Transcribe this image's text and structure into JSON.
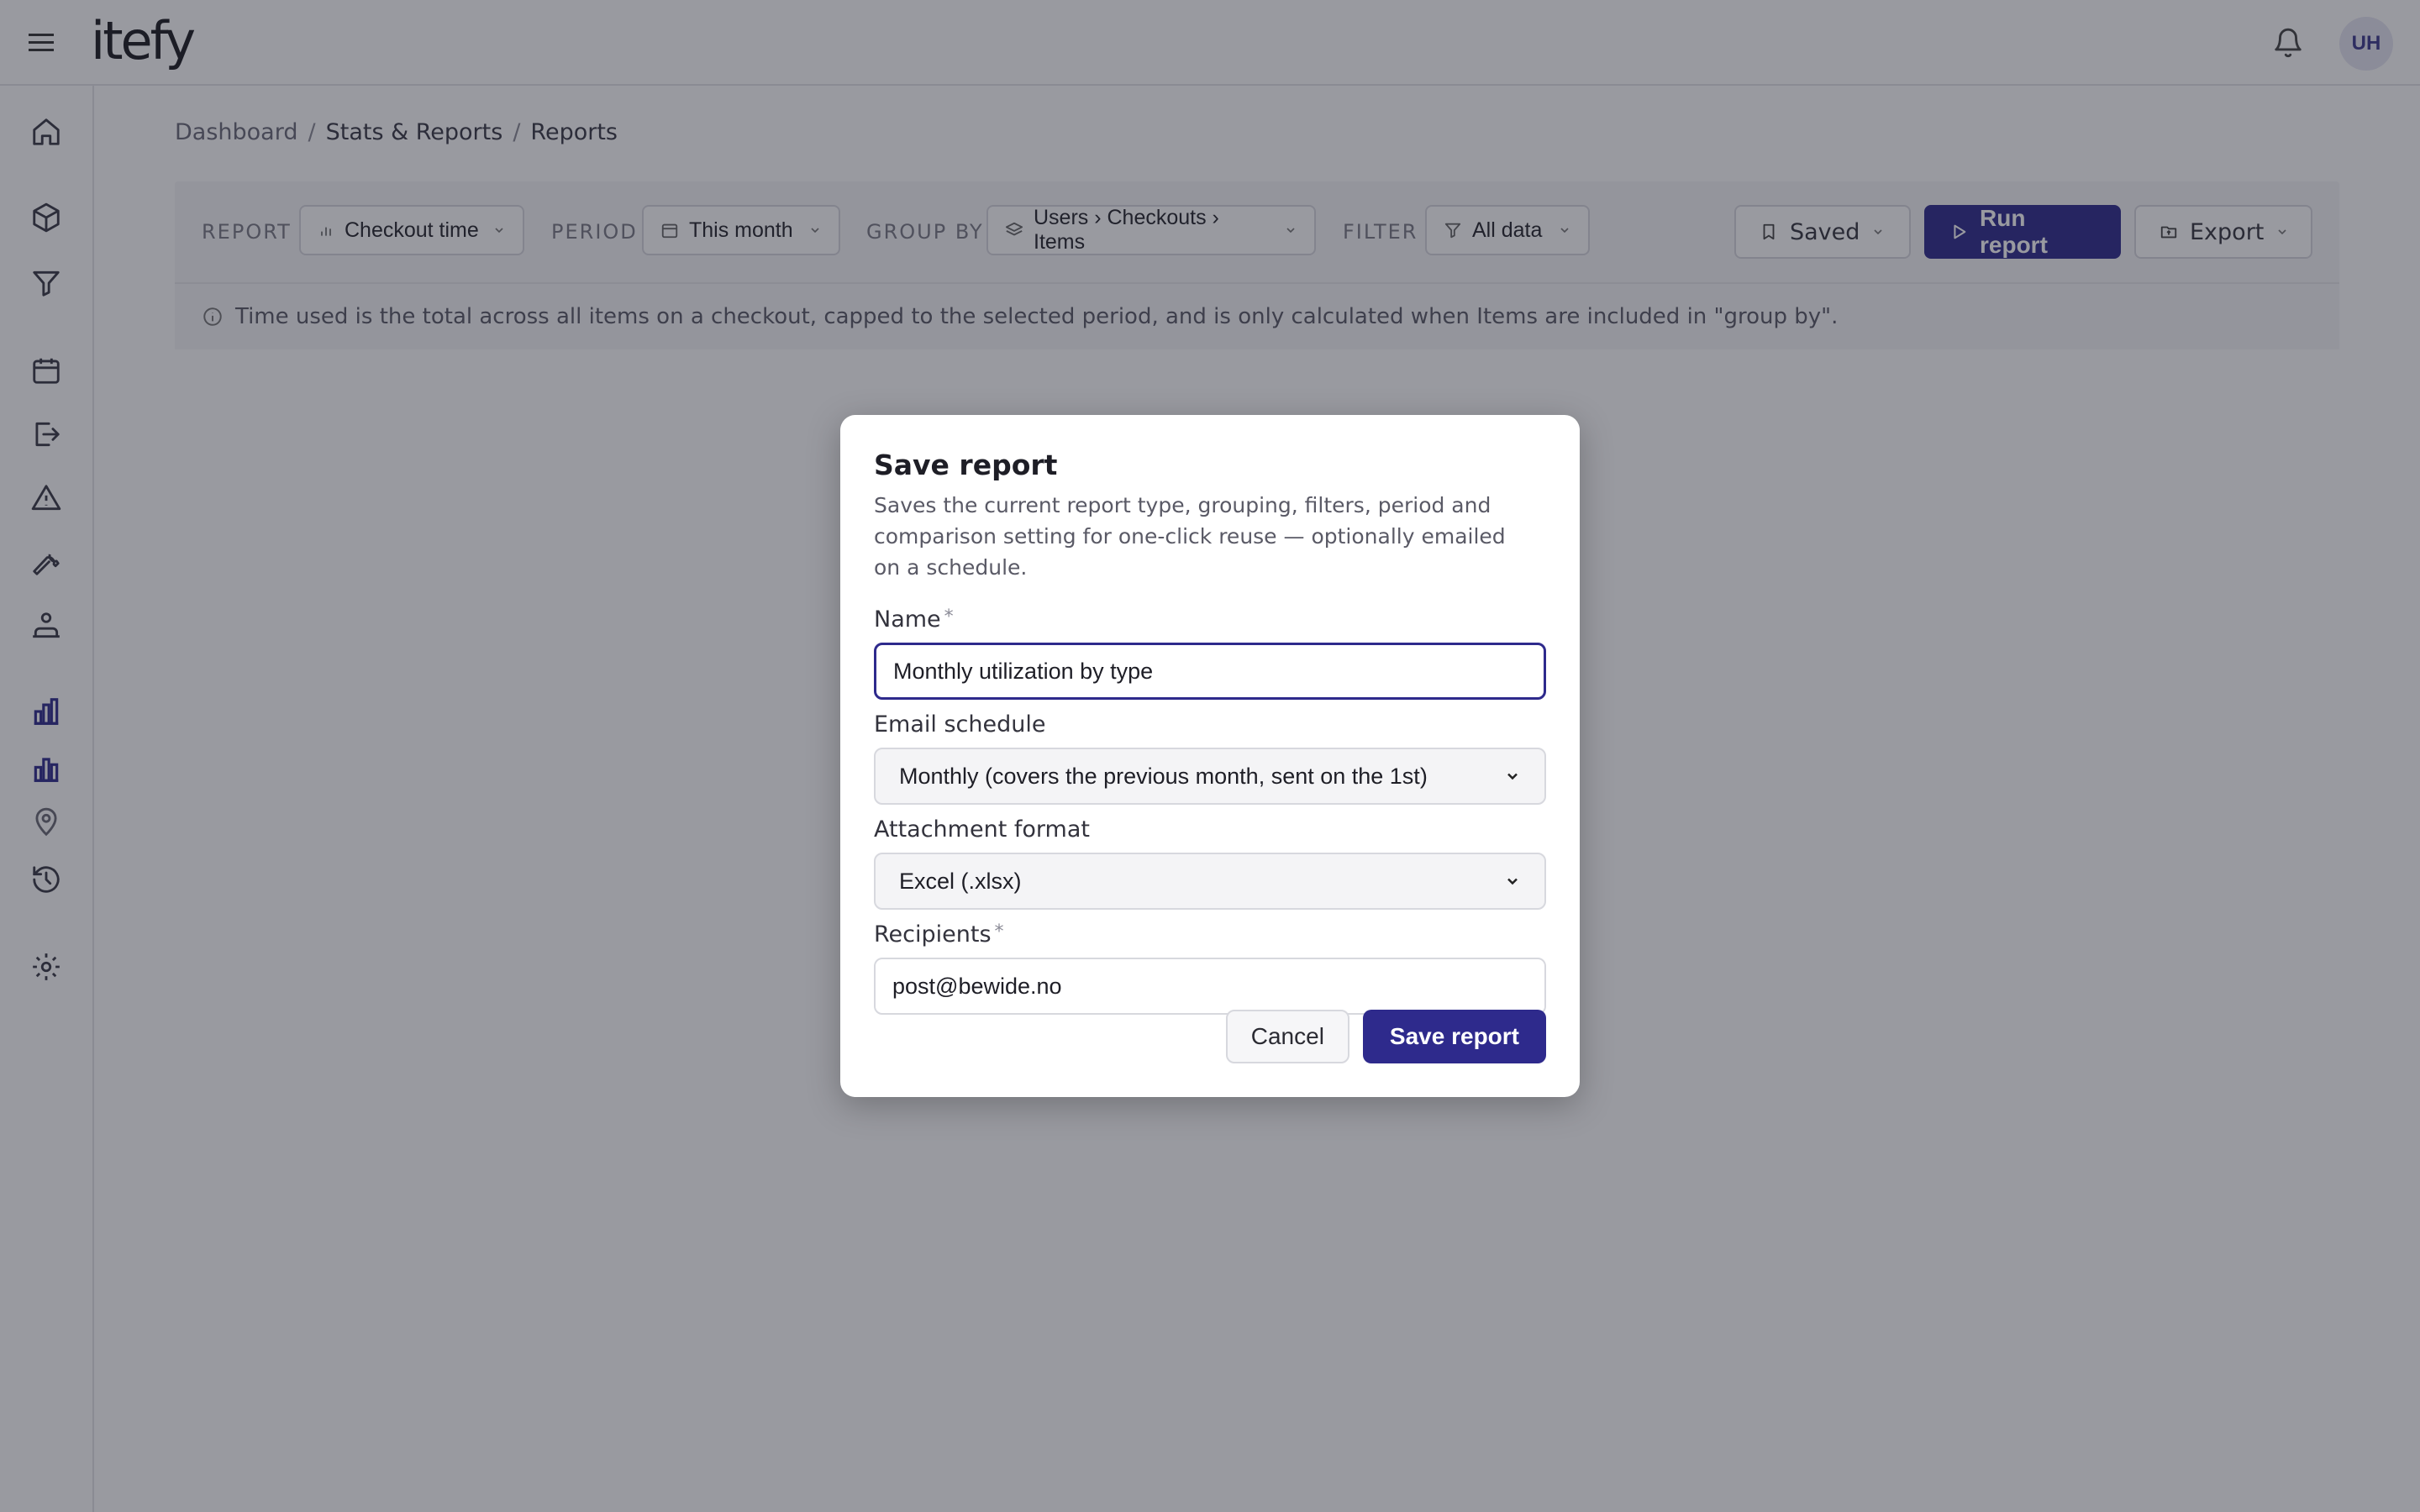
{
  "app": {
    "logo": "itefy",
    "user_initials": "UH"
  },
  "breadcrumb": {
    "items": [
      "Dashboard",
      "Stats & Reports",
      "Reports"
    ],
    "separator": "/"
  },
  "toolbar": {
    "report_label": "REPORT",
    "report_value": "Checkout time",
    "period_label": "PERIOD",
    "period_value": "This month",
    "group_label": "GROUP BY",
    "group_value": "Users › Checkouts › Items",
    "filter_label": "FILTER",
    "filter_value": "All data",
    "saved_label": "Saved",
    "run_label": "Run report",
    "export_label": "Export"
  },
  "info": {
    "text": "Time used is the total across all items on a checkout, capped to the selected period, and is only calculated when Items are included in \"group by\"."
  },
  "modal": {
    "title": "Save report",
    "description": "Saves the current report type, grouping, filters, period and comparison setting for one-click reuse — optionally emailed on a schedule.",
    "name_label": "Name",
    "required_mark": "*",
    "name_value": "Monthly utilization by type",
    "schedule_label": "Email schedule",
    "schedule_value": "Monthly (covers the previous month, sent on the 1st)",
    "format_label": "Attachment format",
    "format_value": "Excel (.xlsx)",
    "recipients_label": "Recipients",
    "recipients_value": "post@bewide.no",
    "cancel_label": "Cancel",
    "save_label": "Save report"
  },
  "colors": {
    "accent": "#2e2a8c",
    "overlay": "rgba(28,30,44,0.45)"
  },
  "icons": {
    "sidebar": [
      "home-icon",
      "box-icon",
      "funnel-icon",
      "calendar-icon",
      "checkout-icon",
      "warning-icon",
      "wrench-icon",
      "org-chart-icon",
      "bar-chart-icon",
      "bar-chart-alt-icon",
      "location-pin-icon",
      "history-icon",
      "settings-icon"
    ]
  }
}
